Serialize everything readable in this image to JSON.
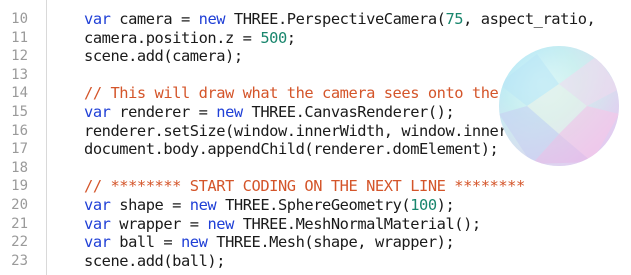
{
  "editor": {
    "lines": [
      {
        "num": "10",
        "tokens": [
          {
            "t": "var",
            "k": "kw"
          },
          {
            "t": " camera = ",
            "k": "tx"
          },
          {
            "t": "new",
            "k": "kw"
          },
          {
            "t": " THREE.PerspectiveCamera(",
            "k": "tx"
          },
          {
            "t": "75",
            "k": "nu"
          },
          {
            "t": ", aspect_ratio,",
            "k": "tx"
          }
        ]
      },
      {
        "num": "11",
        "tokens": [
          {
            "t": "camera.position.z = ",
            "k": "tx"
          },
          {
            "t": "500",
            "k": "nu"
          },
          {
            "t": ";",
            "k": "tx"
          }
        ]
      },
      {
        "num": "12",
        "tokens": [
          {
            "t": "scene.add(camera);",
            "k": "tx"
          }
        ]
      },
      {
        "num": "13",
        "tokens": []
      },
      {
        "num": "14",
        "tokens": [
          {
            "t": "// This will draw what the camera sees onto the screen:",
            "k": "cm"
          }
        ]
      },
      {
        "num": "15",
        "tokens": [
          {
            "t": "var",
            "k": "kw"
          },
          {
            "t": " renderer = ",
            "k": "tx"
          },
          {
            "t": "new",
            "k": "kw"
          },
          {
            "t": " THREE.CanvasRenderer();",
            "k": "tx"
          }
        ]
      },
      {
        "num": "16",
        "tokens": [
          {
            "t": "renderer.setSize(window.innerWidth, window.innerHeight);",
            "k": "tx"
          }
        ]
      },
      {
        "num": "17",
        "tokens": [
          {
            "t": "document.body.appendChild(renderer.domElement);",
            "k": "tx"
          }
        ]
      },
      {
        "num": "18",
        "tokens": []
      },
      {
        "num": "19",
        "tokens": [
          {
            "t": "// ******** START CODING ON THE NEXT LINE ********",
            "k": "cm"
          }
        ]
      },
      {
        "num": "20",
        "tokens": [
          {
            "t": "var",
            "k": "kw"
          },
          {
            "t": " shape = ",
            "k": "tx"
          },
          {
            "t": "new",
            "k": "kw"
          },
          {
            "t": " THREE.SphereGeometry(",
            "k": "tx"
          },
          {
            "t": "100",
            "k": "nu"
          },
          {
            "t": ");",
            "k": "tx"
          }
        ]
      },
      {
        "num": "21",
        "tokens": [
          {
            "t": "var",
            "k": "kw"
          },
          {
            "t": " wrapper = ",
            "k": "tx"
          },
          {
            "t": "new",
            "k": "kw"
          },
          {
            "t": " THREE.MeshNormalMaterial();",
            "k": "tx"
          }
        ]
      },
      {
        "num": "22",
        "tokens": [
          {
            "t": "var",
            "k": "kw"
          },
          {
            "t": " ball = ",
            "k": "tx"
          },
          {
            "t": "new",
            "k": "kw"
          },
          {
            "t": " THREE.Mesh(shape, wrapper);",
            "k": "tx"
          }
        ]
      },
      {
        "num": "23",
        "tokens": [
          {
            "t": "scene.add(ball);",
            "k": "tx"
          }
        ]
      }
    ]
  },
  "preview": {
    "object": "rendered-sphere",
    "colors": [
      "#9fe0ff",
      "#c9f3e0",
      "#f2c9ef",
      "#c8c5f5",
      "#fde0f6"
    ]
  },
  "syntax_colors": {
    "keyword": "#1f3fd6",
    "number": "#19866d",
    "comment": "#d4552a",
    "text": "#1a1a1a"
  }
}
